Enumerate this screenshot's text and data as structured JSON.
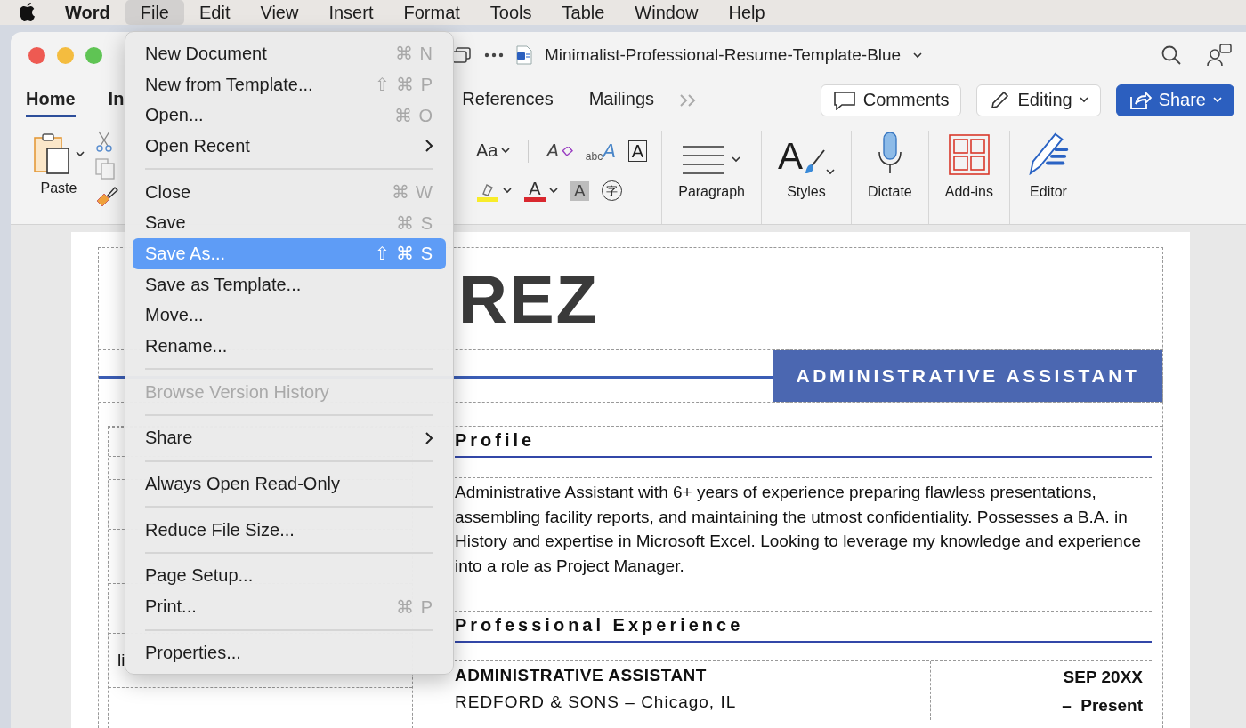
{
  "menu_bar": {
    "items": [
      {
        "label": "Word",
        "kind": "app",
        "selected": false
      },
      {
        "label": "File",
        "kind": "menu",
        "selected": true
      },
      {
        "label": "Edit",
        "kind": "menu",
        "selected": false
      },
      {
        "label": "View",
        "kind": "menu",
        "selected": false
      },
      {
        "label": "Insert",
        "kind": "menu",
        "selected": false
      },
      {
        "label": "Format",
        "kind": "menu",
        "selected": false
      },
      {
        "label": "Tools",
        "kind": "menu",
        "selected": false
      },
      {
        "label": "Table",
        "kind": "menu",
        "selected": false
      },
      {
        "label": "Window",
        "kind": "menu",
        "selected": false
      },
      {
        "label": "Help",
        "kind": "menu",
        "selected": false
      }
    ]
  },
  "window": {
    "title": "Minimalist-Professional-Resume-Template-Blue"
  },
  "ribbon_tabs": [
    {
      "label": "Home",
      "selected": true
    },
    {
      "label": "In",
      "selected": false
    },
    {
      "label": "References",
      "selected": false
    },
    {
      "label": "Mailings",
      "selected": false
    }
  ],
  "header_buttons": [
    {
      "label": "Comments",
      "kind": "comments"
    },
    {
      "label": "Editing",
      "kind": "editing"
    },
    {
      "label": "Share",
      "kind": "share"
    }
  ],
  "paste": {
    "label": "Paste"
  },
  "font_controls": [
    {
      "kind": "change-case",
      "glyph": "Aa"
    },
    {
      "kind": "clear-formatting",
      "glyph": "A"
    },
    {
      "kind": "text-effects",
      "glyph": "abc",
      "glyph2": "A"
    },
    {
      "kind": "text-box",
      "glyph": "A"
    },
    {
      "kind": "highlight"
    },
    {
      "kind": "font-color",
      "glyph": "A"
    },
    {
      "kind": "shading",
      "glyph": "A"
    },
    {
      "kind": "phonetic",
      "glyph": "字"
    }
  ],
  "ribbon_groups": [
    {
      "kind": "paragraph",
      "label": "Paragraph"
    },
    {
      "kind": "styles",
      "label": "Styles",
      "glyph": "A"
    },
    {
      "kind": "dictate",
      "label": "Dictate"
    },
    {
      "kind": "addins",
      "label": "Add-ins"
    },
    {
      "kind": "editor",
      "label": "Editor"
    }
  ],
  "document": {
    "name_end": "REZ",
    "job_title_badge": "ADMINISTRATIVE ASSISTANT",
    "left_column_text": "li",
    "sections": [
      {
        "heading": "Profile",
        "kind": "text",
        "text": "Administrative Assistant with 6+ years of experience preparing flawless presentations, assembling facility reports, and maintaining the utmost confidentiality. Possesses a B.A. in History and expertise in Microsoft Excel. Looking to leverage my knowledge and experience into a role as Project Manager."
      },
      {
        "heading": "Professional Experience",
        "kind": "jobs",
        "jobs": [
          {
            "title": "ADMINISTRATIVE ASSISTANT",
            "company": "REDFORD & SONS – Chicago, IL",
            "start": "SEP 20XX",
            "end": "–  Present"
          }
        ]
      }
    ]
  },
  "file_menu": {
    "items": [
      {
        "kind": "item",
        "label": "New Document",
        "shortcut": "⌘ N",
        "selected": false,
        "disabled": false,
        "submenu": false
      },
      {
        "kind": "item",
        "label": "New from Template...",
        "shortcut": "⇧ ⌘ P",
        "selected": false,
        "disabled": false,
        "submenu": false
      },
      {
        "kind": "item",
        "label": "Open...",
        "shortcut": "⌘ O",
        "selected": false,
        "disabled": false,
        "submenu": false
      },
      {
        "kind": "item",
        "label": "Open Recent",
        "selected": false,
        "disabled": false,
        "submenu": true
      },
      {
        "kind": "separator"
      },
      {
        "kind": "item",
        "label": "Close",
        "shortcut": "⌘ W",
        "selected": false,
        "disabled": false,
        "submenu": false
      },
      {
        "kind": "item",
        "label": "Save",
        "shortcut": "⌘ S",
        "selected": false,
        "disabled": false,
        "submenu": false
      },
      {
        "kind": "item",
        "label": "Save As...",
        "shortcut": "⇧ ⌘ S",
        "selected": true,
        "disabled": false,
        "submenu": false
      },
      {
        "kind": "item",
        "label": "Save as Template...",
        "selected": false,
        "disabled": false,
        "submenu": false
      },
      {
        "kind": "item",
        "label": "Move...",
        "selected": false,
        "disabled": false,
        "submenu": false
      },
      {
        "kind": "item",
        "label": "Rename...",
        "selected": false,
        "disabled": false,
        "submenu": false
      },
      {
        "kind": "separator"
      },
      {
        "kind": "item",
        "label": "Browse Version History",
        "selected": false,
        "disabled": true,
        "submenu": false
      },
      {
        "kind": "separator"
      },
      {
        "kind": "item",
        "label": "Share",
        "selected": false,
        "disabled": false,
        "submenu": true
      },
      {
        "kind": "separator"
      },
      {
        "kind": "item",
        "label": "Always Open Read-Only",
        "selected": false,
        "disabled": false,
        "submenu": false
      },
      {
        "kind": "separator"
      },
      {
        "kind": "item",
        "label": "Reduce File Size...",
        "selected": false,
        "disabled": false,
        "submenu": false
      },
      {
        "kind": "separator"
      },
      {
        "kind": "item",
        "label": "Page Setup...",
        "selected": false,
        "disabled": false,
        "submenu": false
      },
      {
        "kind": "item",
        "label": "Print...",
        "shortcut": "⌘ P",
        "selected": false,
        "disabled": false,
        "submenu": false
      },
      {
        "kind": "separator"
      },
      {
        "kind": "item",
        "label": "Properties...",
        "selected": false,
        "disabled": false,
        "submenu": false
      }
    ]
  }
}
